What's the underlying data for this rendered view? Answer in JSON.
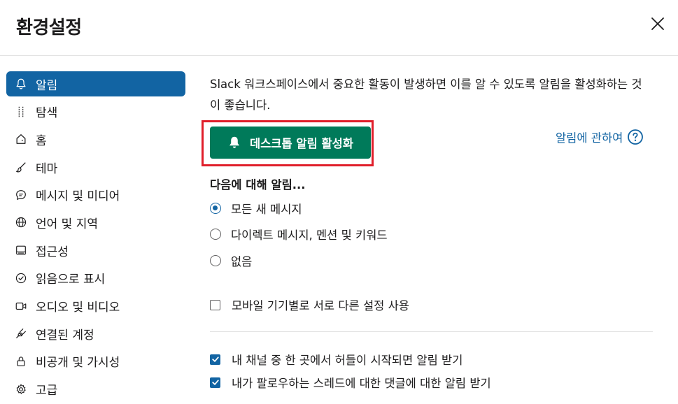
{
  "dialog": {
    "title": "환경설정",
    "close_icon": "close-icon"
  },
  "sidebar": {
    "items": [
      {
        "label": "알림",
        "icon": "bell-icon",
        "active": true
      },
      {
        "label": "탐색",
        "icon": "sliders-icon"
      },
      {
        "label": "홈",
        "icon": "home-icon"
      },
      {
        "label": "테마",
        "icon": "brush-icon"
      },
      {
        "label": "메시지 및 미디어",
        "icon": "message-icon"
      },
      {
        "label": "언어 및 지역",
        "icon": "globe-icon"
      },
      {
        "label": "접근성",
        "icon": "keyboard-icon"
      },
      {
        "label": "읽음으로 표시",
        "icon": "check-circle-icon"
      },
      {
        "label": "오디오 및 비디오",
        "icon": "video-icon"
      },
      {
        "label": "연결된 계정",
        "icon": "plug-icon"
      },
      {
        "label": "비공개 및 가시성",
        "icon": "lock-icon"
      },
      {
        "label": "고급",
        "icon": "gear-icon"
      }
    ]
  },
  "main": {
    "description": "Slack 워크스페이스에서 중요한 활동이 발생하면 이를 알 수 있도록 알림을 활성화하는 것이 좋습니다.",
    "enable_button_label": "데스크톱 알림 활성화",
    "about_link": "알림에 관하여",
    "notify_section_title": "다음에 대해 알림...",
    "radio_options": [
      {
        "label": "모든 새 메시지",
        "checked": true
      },
      {
        "label": "다이렉트 메시지, 멘션 및 키워드",
        "checked": false
      },
      {
        "label": "없음",
        "checked": false
      }
    ],
    "mobile_checkbox": {
      "label": "모바일 기기별로 서로 다른 설정 사용",
      "checked": false
    },
    "checkboxes": [
      {
        "label": "내 채널 중 한 곳에서 허들이 시작되면 알림 받기",
        "checked": true
      },
      {
        "label": "내가 팔로우하는 스레드에 대한 댓글에 대한 알림 받기",
        "checked": true
      }
    ]
  },
  "colors": {
    "accent": "#1264a3",
    "button_green": "#007a5a",
    "highlight_red": "#e01e2a"
  }
}
